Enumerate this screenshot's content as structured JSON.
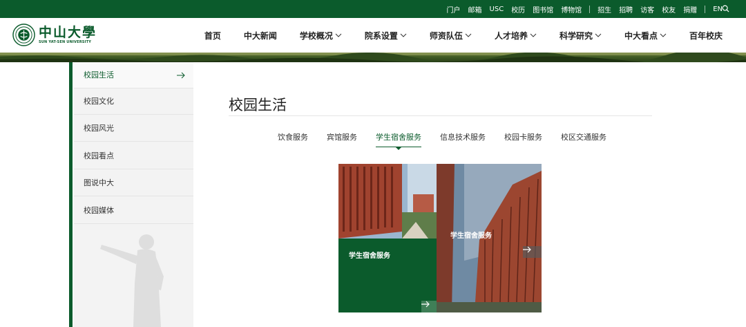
{
  "topbar": {
    "links_a": [
      "门户",
      "邮箱",
      "USC",
      "校历",
      "图书馆",
      "博物馆"
    ],
    "links_b": [
      "招生",
      "招聘",
      "访客",
      "校友",
      "捐赠"
    ],
    "lang": "EN",
    "search_icon": "search-icon"
  },
  "logo": {
    "cn": "中山大學",
    "en": "SUN YAT-SEN UNIVERSITY"
  },
  "nav": {
    "items": [
      {
        "label": "首页",
        "dropdown": false
      },
      {
        "label": "中大新闻",
        "dropdown": false
      },
      {
        "label": "学校概况",
        "dropdown": true
      },
      {
        "label": "院系设置",
        "dropdown": true
      },
      {
        "label": "师资队伍",
        "dropdown": true
      },
      {
        "label": "人才培养",
        "dropdown": true
      },
      {
        "label": "科学研究",
        "dropdown": true
      },
      {
        "label": "中大看点",
        "dropdown": true
      },
      {
        "label": "百年校庆",
        "dropdown": false
      }
    ]
  },
  "sidebar": {
    "items": [
      {
        "label": "校园生活",
        "active": true
      },
      {
        "label": "校园文化",
        "active": false
      },
      {
        "label": "校园风光",
        "active": false
      },
      {
        "label": "校园看点",
        "active": false
      },
      {
        "label": "图说中大",
        "active": false
      },
      {
        "label": "校园媒体",
        "active": false
      }
    ]
  },
  "main": {
    "title": "校园生活",
    "tabs": [
      {
        "label": "饮食服务",
        "active": false
      },
      {
        "label": "宾馆服务",
        "active": false
      },
      {
        "label": "学生宿舍服务",
        "active": true
      },
      {
        "label": "信息技术服务",
        "active": false
      },
      {
        "label": "校园卡服务",
        "active": false
      },
      {
        "label": "校区交通服务",
        "active": false
      }
    ],
    "cards": [
      {
        "label": "学生宿舍服务"
      },
      {
        "label": "学生宿舍服务"
      }
    ]
  },
  "colors": {
    "brand_green": "#0b5b2c"
  }
}
